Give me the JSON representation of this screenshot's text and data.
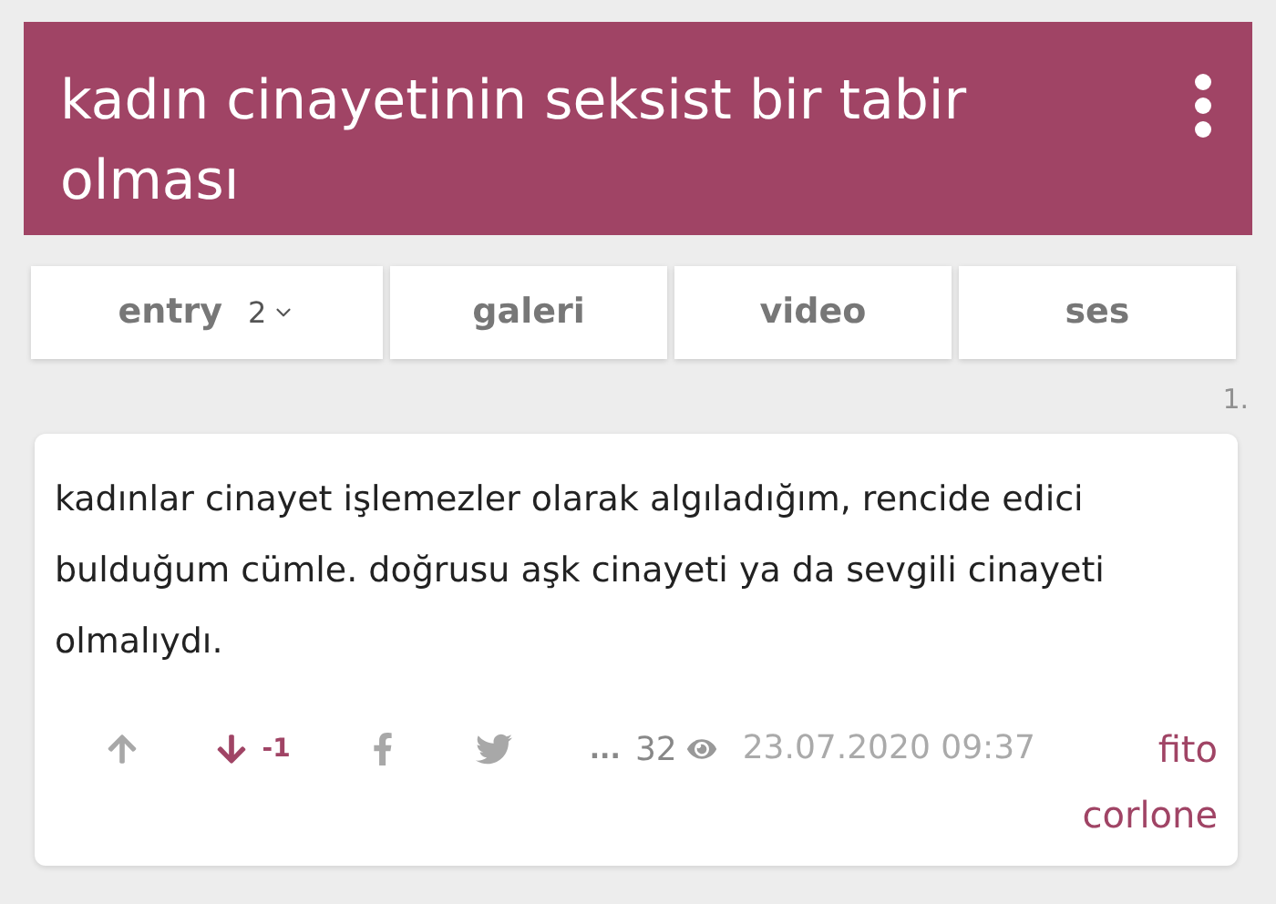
{
  "header": {
    "title": "kadın cinayetinin seksist bir tabir olması"
  },
  "tabs": [
    {
      "label": "entry",
      "count": "2"
    },
    {
      "label": "galeri"
    },
    {
      "label": "video"
    },
    {
      "label": "ses"
    }
  ],
  "entry": {
    "number": "1.",
    "text": "kadınlar cinayet işlemezler olarak algıladığım, rencide edici bulduğum cümle. doğrusu aşk cinayeti ya da sevgili cinayeti olmalıydı.",
    "upvoted": false,
    "downvoted": true,
    "score": "-1",
    "more": "...",
    "views": "32",
    "date": "23.07.2020 09:37",
    "author": "fito corlone"
  }
}
